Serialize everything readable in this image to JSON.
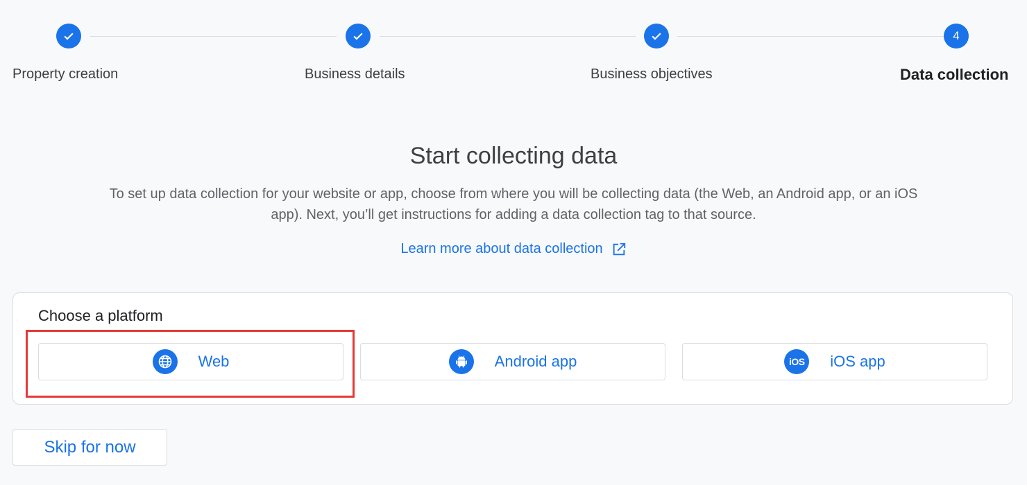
{
  "stepper": {
    "steps": [
      {
        "label": "Property creation",
        "status": "done",
        "icon": "check-icon"
      },
      {
        "label": "Business details",
        "status": "done",
        "icon": "check-icon"
      },
      {
        "label": "Business objectives",
        "status": "done",
        "icon": "check-icon"
      },
      {
        "label": "Data collection",
        "status": "current",
        "number": "4"
      }
    ]
  },
  "main": {
    "title": "Start collecting data",
    "description": "To set up data collection for your website or app, choose from where you will be collecting data (the Web, an Android app, or an iOS app). Next, you’ll get instructions for adding a data collection tag to that source.",
    "learn_more_label": "Learn more about data collection",
    "learn_more_icon": "open-in-new-icon"
  },
  "platform": {
    "heading": "Choose a platform",
    "options": [
      {
        "label": "Web",
        "icon": "globe-icon"
      },
      {
        "label": "Android app",
        "icon": "android-icon"
      },
      {
        "label": "iOS app",
        "icon": "ios-icon",
        "icon_text": "iOS"
      }
    ]
  },
  "actions": {
    "skip_label": "Skip for now"
  },
  "colors": {
    "accent": "#1a73e8",
    "highlight": "#e53935",
    "background": "#f8f9fa"
  }
}
